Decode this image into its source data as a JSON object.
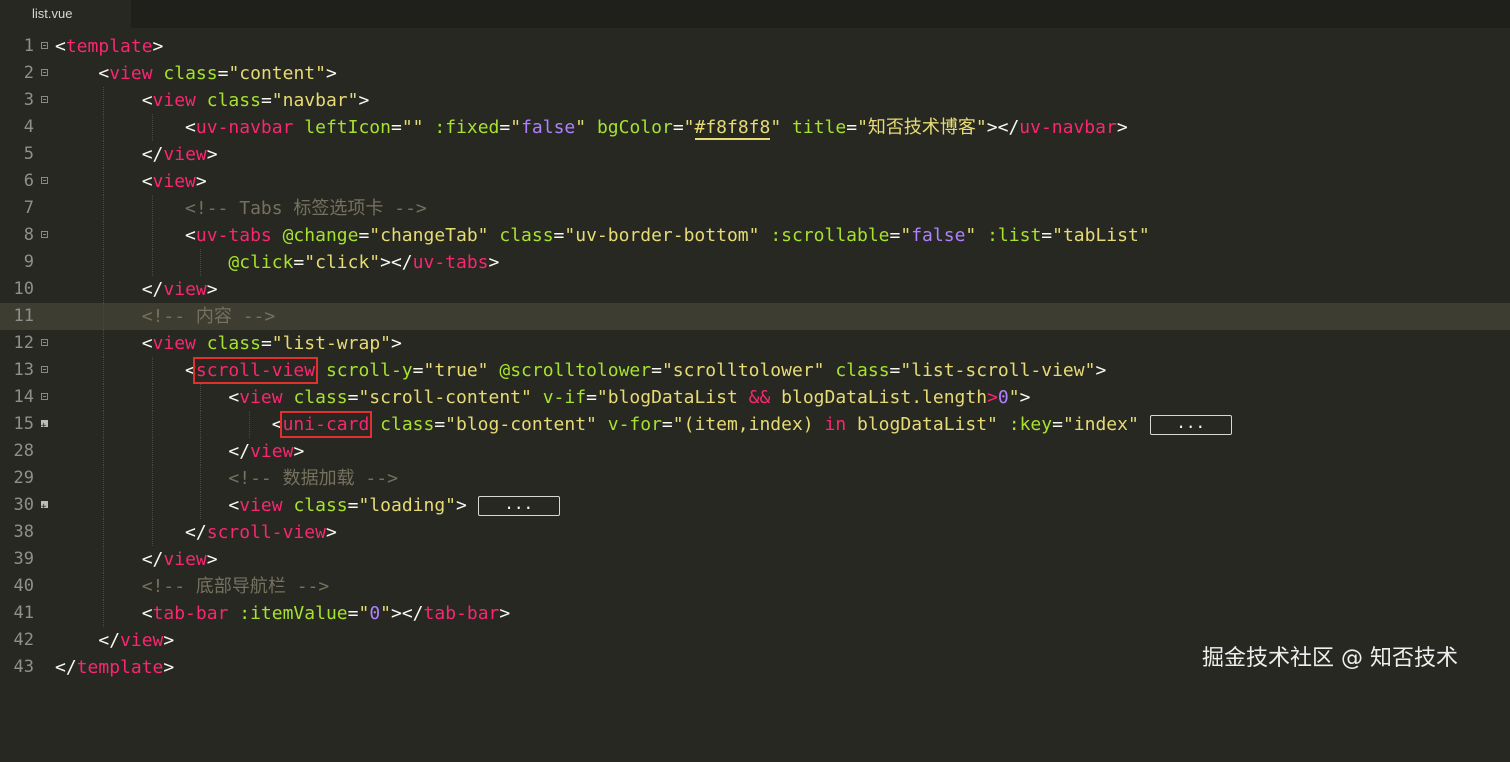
{
  "tab": {
    "title": "list.vue"
  },
  "watermark": "掘金技术社区 @ 知否技术",
  "lines": [
    {
      "num": "1",
      "fold": "open"
    },
    {
      "num": "2",
      "fold": "open"
    },
    {
      "num": "3",
      "fold": "open"
    },
    {
      "num": "4",
      "fold": ""
    },
    {
      "num": "5",
      "fold": ""
    },
    {
      "num": "6",
      "fold": "open"
    },
    {
      "num": "7",
      "fold": ""
    },
    {
      "num": "8",
      "fold": "open"
    },
    {
      "num": "9",
      "fold": ""
    },
    {
      "num": "10",
      "fold": ""
    },
    {
      "num": "11",
      "fold": ""
    },
    {
      "num": "12",
      "fold": "open"
    },
    {
      "num": "13",
      "fold": "open"
    },
    {
      "num": "14",
      "fold": "open"
    },
    {
      "num": "15",
      "fold": "closed"
    },
    {
      "num": "28",
      "fold": ""
    },
    {
      "num": "29",
      "fold": ""
    },
    {
      "num": "30",
      "fold": "closed"
    },
    {
      "num": "38",
      "fold": ""
    },
    {
      "num": "39",
      "fold": ""
    },
    {
      "num": "40",
      "fold": ""
    },
    {
      "num": "41",
      "fold": ""
    },
    {
      "num": "42",
      "fold": ""
    },
    {
      "num": "43",
      "fold": ""
    }
  ],
  "code": {
    "l1": {
      "tag": "template"
    },
    "l2": {
      "tag": "view",
      "attr": "class",
      "val": "\"content\""
    },
    "l3": {
      "tag": "view",
      "attr": "class",
      "val": "\"navbar\""
    },
    "l4": {
      "tag": "uv-navbar",
      "a1": "leftIcon",
      "v1": "\"\"",
      "a2": ":fixed",
      "v2q1": "\"",
      "v2": "false",
      "v2q2": "\"",
      "a3": "bgColor",
      "v3": "#f8f8f8",
      "a4": "title",
      "v4": "\"知否技术博客\"",
      "close": "uv-navbar"
    },
    "l5": {
      "close": "view"
    },
    "l6": {
      "tag": "view"
    },
    "l7": {
      "comment": "<!-- Tabs 标签选项卡 -->"
    },
    "l8": {
      "tag": "uv-tabs",
      "a1": "@change",
      "v1": "\"changeTab\"",
      "a2": "class",
      "v2": "\"uv-border-bottom\"",
      "a3": ":scrollable",
      "v3": "false",
      "a4": ":list",
      "v4": "\"tabList\""
    },
    "l9": {
      "a1": "@click",
      "v1": "\"click\"",
      "close": "uv-tabs"
    },
    "l10": {
      "close": "view"
    },
    "l11": {
      "comment": "<!-- 内容 -->"
    },
    "l12": {
      "tag": "view",
      "attr": "class",
      "val": "\"list-wrap\""
    },
    "l13": {
      "tag": "scroll-view",
      "a1": "scroll-y",
      "v1": "\"true\"",
      "a2": "@scrolltolower",
      "v2": "\"scrolltolower\"",
      "a3": "class",
      "v3": "\"list-scroll-view\""
    },
    "l14": {
      "tag": "view",
      "a1": "class",
      "v1": "\"scroll-content\"",
      "a2": "v-if",
      "v2": "\"blogDataList ",
      "op": "&&",
      "v2b": " blogDataList.length",
      "gt": ">",
      "num": "0",
      "v2c": "\""
    },
    "l15": {
      "tag": "uni-card",
      "a1": "class",
      "v1": "\"blog-content\"",
      "a2": "v-for",
      "v2a": "\"(item,index) ",
      "kw": "in",
      "v2b": " blogDataList\"",
      "a3": ":key",
      "v3": "\"index\"",
      "fold": "..."
    },
    "l28": {
      "close": "view"
    },
    "l29": {
      "comment": "<!-- 数据加载 -->"
    },
    "l30": {
      "tag": "view",
      "a1": "class",
      "v1": "\"loading\"",
      "fold": "..."
    },
    "l38": {
      "close": "scroll-view"
    },
    "l39": {
      "close": "view"
    },
    "l40": {
      "comment": "<!-- 底部导航栏 -->"
    },
    "l41": {
      "tag": "tab-bar",
      "a1": ":itemValue",
      "v1q1": "\"",
      "v1": "0",
      "v1q2": "\"",
      "close": "tab-bar"
    },
    "l42": {
      "close": "view"
    },
    "l43": {
      "close": "template"
    }
  }
}
